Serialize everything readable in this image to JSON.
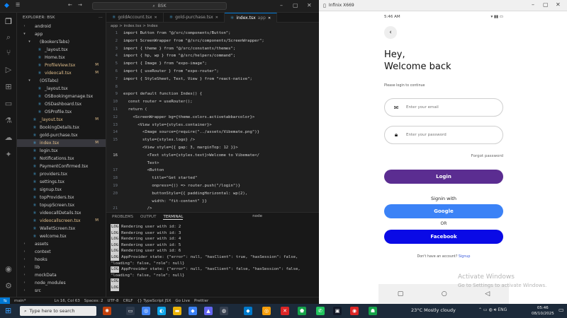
{
  "vscode": {
    "search": "BSK",
    "explorer_title": "EXPLORER: BSK",
    "tree": [
      {
        "label": "android",
        "type": "folder",
        "indent": 1,
        "open": false
      },
      {
        "label": "app",
        "type": "folder",
        "indent": 1,
        "open": true
      },
      {
        "label": "(BookersTabs)",
        "type": "folder",
        "indent": 2,
        "open": true
      },
      {
        "label": "_layout.tsx",
        "type": "tsx",
        "indent": 3
      },
      {
        "label": "Home.tsx",
        "type": "tsx",
        "indent": 3
      },
      {
        "label": "ProfileView.tsx",
        "type": "tsx",
        "indent": 3,
        "badge": "M"
      },
      {
        "label": "videocall.tsx",
        "type": "tsx",
        "indent": 3,
        "badge": "M"
      },
      {
        "label": "(OSTabs)",
        "type": "folder",
        "indent": 2,
        "open": true
      },
      {
        "label": "_layout.tsx",
        "type": "tsx",
        "indent": 3
      },
      {
        "label": "OSBookingmanage.tsx",
        "type": "tsx",
        "indent": 3
      },
      {
        "label": "OSDashboard.tsx",
        "type": "tsx",
        "indent": 3
      },
      {
        "label": "OSProfile.tsx",
        "type": "tsx",
        "indent": 3
      },
      {
        "label": "_layout.tsx",
        "type": "tsx",
        "indent": 2,
        "badge": "M"
      },
      {
        "label": "BookingDetails.tsx",
        "type": "tsx",
        "indent": 2
      },
      {
        "label": "gold-purchase.tsx",
        "type": "tsx",
        "indent": 2
      },
      {
        "label": "index.tsx",
        "type": "tsx",
        "indent": 2,
        "badge": "M",
        "selected": true
      },
      {
        "label": "login.tsx",
        "type": "tsx",
        "indent": 2
      },
      {
        "label": "Notifications.tsx",
        "type": "tsx",
        "indent": 2
      },
      {
        "label": "PaymentConfirmed.tsx",
        "type": "tsx",
        "indent": 2
      },
      {
        "label": "providers.tsx",
        "type": "tsx",
        "indent": 2
      },
      {
        "label": "settings.tsx",
        "type": "tsx",
        "indent": 2
      },
      {
        "label": "signup.tsx",
        "type": "tsx",
        "indent": 2
      },
      {
        "label": "topProviders.tsx",
        "type": "tsx",
        "indent": 2
      },
      {
        "label": "topupScreen.tsx",
        "type": "tsx",
        "indent": 2
      },
      {
        "label": "videocallDetails.tsx",
        "type": "tsx",
        "indent": 2
      },
      {
        "label": "videocallscreen.tsx",
        "type": "tsx",
        "indent": 2,
        "badge": "M"
      },
      {
        "label": "WalletScreen.tsx",
        "type": "tsx",
        "indent": 2
      },
      {
        "label": "welcome.tsx",
        "type": "tsx",
        "indent": 2
      },
      {
        "label": "assets",
        "type": "folder",
        "indent": 1,
        "open": false
      },
      {
        "label": "context",
        "type": "folder",
        "indent": 1,
        "open": false
      },
      {
        "label": "hooks",
        "type": "folder",
        "indent": 1,
        "open": false
      },
      {
        "label": "lib",
        "type": "folder",
        "indent": 1,
        "open": false
      },
      {
        "label": "mockData",
        "type": "folder",
        "indent": 1,
        "open": false
      },
      {
        "label": "node_modules",
        "type": "folder",
        "indent": 1,
        "open": false
      },
      {
        "label": "src",
        "type": "folder",
        "indent": 1,
        "open": false
      }
    ],
    "tabs": [
      {
        "label": "goldAccount.tsx",
        "active": false
      },
      {
        "label": "gold-purchase.tsx",
        "active": false
      },
      {
        "label": "index.tsx",
        "extra": "app",
        "active": true
      }
    ],
    "breadcrumb": "app > index.tsx > Index",
    "code": [
      {
        "n": "1",
        "t": "import Button from \"@/src/components/Button\";"
      },
      {
        "n": "2",
        "t": "import ScreenWrapper from \"@/src/components/ScreenWrapper\";"
      },
      {
        "n": "3",
        "t": "import { theme } from \"@/src/constants/themes\";"
      },
      {
        "n": "4",
        "t": "import { hp, wp } from \"@/src/helpers/command\";"
      },
      {
        "n": "5",
        "t": "import { Image } from \"expo-image\";"
      },
      {
        "n": "6",
        "t": "import { useRouter } from \"expo-router\";"
      },
      {
        "n": "7",
        "t": "import { StyleSheet, Text, View } from \"react-native\";"
      },
      {
        "n": "8",
        "t": ""
      },
      {
        "n": "9",
        "t": "export default function Index() {"
      },
      {
        "n": "10",
        "t": "  const router = useRouter();"
      },
      {
        "n": "11",
        "t": "  return ("
      },
      {
        "n": "12",
        "t": "    <ScreenWrapper bg={theme.colors.activetabbarcolor}>"
      },
      {
        "n": "13",
        "t": "      <View style={styles.container}>"
      },
      {
        "n": "14",
        "t": "        <Image source={require(\"../assets/Vibemate.png\")}"
      },
      {
        "n": "15",
        "t": "        style={styles.logo} />"
      },
      {
        "n": "",
        "t": "        <View style={{ gap: 3, marginTop: 12 }}>"
      },
      {
        "n": "16",
        "t": "          <Text style={styles.text}>Welcome to Vibemate</"
      },
      {
        "n": "",
        "t": "          Text>"
      },
      {
        "n": "17",
        "t": "          <Button"
      },
      {
        "n": "18",
        "t": "            title=\"Get started\""
      },
      {
        "n": "19",
        "t": "            onpress={() => router.push(\"/login\")}"
      },
      {
        "n": "20",
        "t": "            buttonStyle={{ paddingHorizontal: wp(2),"
      },
      {
        "n": "",
        "t": "            width: \"fit-content\" }}"
      },
      {
        "n": "21",
        "t": "          />"
      },
      {
        "n": "22",
        "t": "        </View>"
      },
      {
        "n": "23",
        "t": "      </View>"
      },
      {
        "n": "24",
        "t": "    </ScreenWrapper>"
      }
    ],
    "panel_tabs": [
      "PROBLEMS",
      "OUTPUT",
      "TERMINAL"
    ],
    "panel_active": "TERMINAL",
    "panel_right": "node",
    "terminal": [
      {
        "log": "LOG",
        "text": "Rendering user with id: 2"
      },
      {
        "log": "LOG",
        "text": "Rendering user with id: 3"
      },
      {
        "log": "LOG",
        "text": "Rendering user with id: 4"
      },
      {
        "log": "LOG",
        "text": "Rendering user with id: 5"
      },
      {
        "log": "LOG",
        "text": "Rendering user with id: 6"
      },
      {
        "log": "LOG",
        "text": "AppProvider state: {\"error\": null, \"hasClient\": true, \"hasSession\": false,"
      },
      {
        "log": "",
        "text": "\"loading\": false, \"role\": null}"
      },
      {
        "log": "LOG",
        "text": "AppProvider state: {\"error\": null, \"hasClient\": false, \"hasSession\": false,"
      },
      {
        "log": "",
        "text": "\"loading\": false, \"role\": null}"
      },
      {
        "log": "LOG",
        "text": ""
      },
      {
        "log": "LOG",
        "text": ""
      }
    ],
    "status": {
      "branch": "main*",
      "position": "Ln 16, Col 63",
      "spaces": "Spaces: 2",
      "encoding": "UTF-8",
      "eol": "CRLF",
      "language": "{} TypeScript JSX",
      "golive": "Go Live",
      "prettier": "Prettier"
    }
  },
  "emulator": {
    "title": "Infinix X669",
    "status_time": "5:46 AM",
    "heading_line1": "Hey,",
    "heading_line2": "Welcome back",
    "subtitle": "Please login to continue",
    "email_placeholder": "Enter your email",
    "password_placeholder": "Enter your password",
    "forgot": "Forgot password",
    "login_label": "Login",
    "signin_with": "Signin with",
    "google_label": "Google",
    "or_label": "OR",
    "facebook_label": "Facebook",
    "noacc_text": "Don't have an account?",
    "signup_link": "Signup",
    "colors": {
      "login": "#5b2d91",
      "google": "#3b82f6",
      "facebook": "#0a0ae6"
    }
  },
  "watermark": {
    "line1": "Activate Windows",
    "line2": "Go to Settings to activate Windows."
  },
  "taskbar": {
    "search_placeholder": "Type here to search",
    "weather": "23°C  Mostly cloudy",
    "time": "05:46",
    "date": "08/10/2025"
  }
}
